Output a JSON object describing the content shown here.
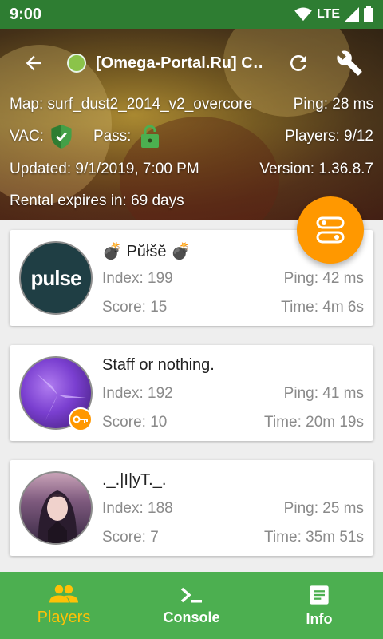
{
  "status_bar": {
    "time": "9:00",
    "network": "LTE"
  },
  "toolbar": {
    "title": "[Omega-Portal.Ru] C…"
  },
  "server": {
    "map_label": "Map: surf_dust2_2014_v2_overcore",
    "ping_label": "Ping: 28 ms",
    "vac_label": "VAC:",
    "pass_label": "Pass:",
    "players_label": "Players: 9/12",
    "updated_label": "Updated: 9/1/2019, 7:00 PM",
    "version_label": "Version: 1.36.8.7",
    "rental_label": "Rental expires in: 69 days"
  },
  "players": [
    {
      "name": "💣 Pŭłšě 💣",
      "index": "Index: 199",
      "ping": "Ping: 42 ms",
      "score": "Score: 15",
      "time": "Time: 4m 6s",
      "avatar_text": "pulse"
    },
    {
      "name": "Staff or nothing.",
      "index": "Index: 192",
      "ping": "Ping: 41 ms",
      "score": "Score: 10",
      "time": "Time: 20m 19s"
    },
    {
      "name": "._.|I|yT._.",
      "index": "Index: 188",
      "ping": "Ping: 25 ms",
      "score": "Score: 7",
      "time": "Time: 35m 51s"
    }
  ],
  "nav": [
    {
      "label": "Players",
      "icon": "people-icon",
      "active": true
    },
    {
      "label": "Console",
      "icon": "terminal-icon"
    },
    {
      "label": "Info",
      "icon": "document-icon"
    }
  ],
  "colors": {
    "status_bar": "#2e7d32",
    "nav_bg": "#4caf50",
    "accent": "#ff9800",
    "active_nav": "#ffc107"
  }
}
